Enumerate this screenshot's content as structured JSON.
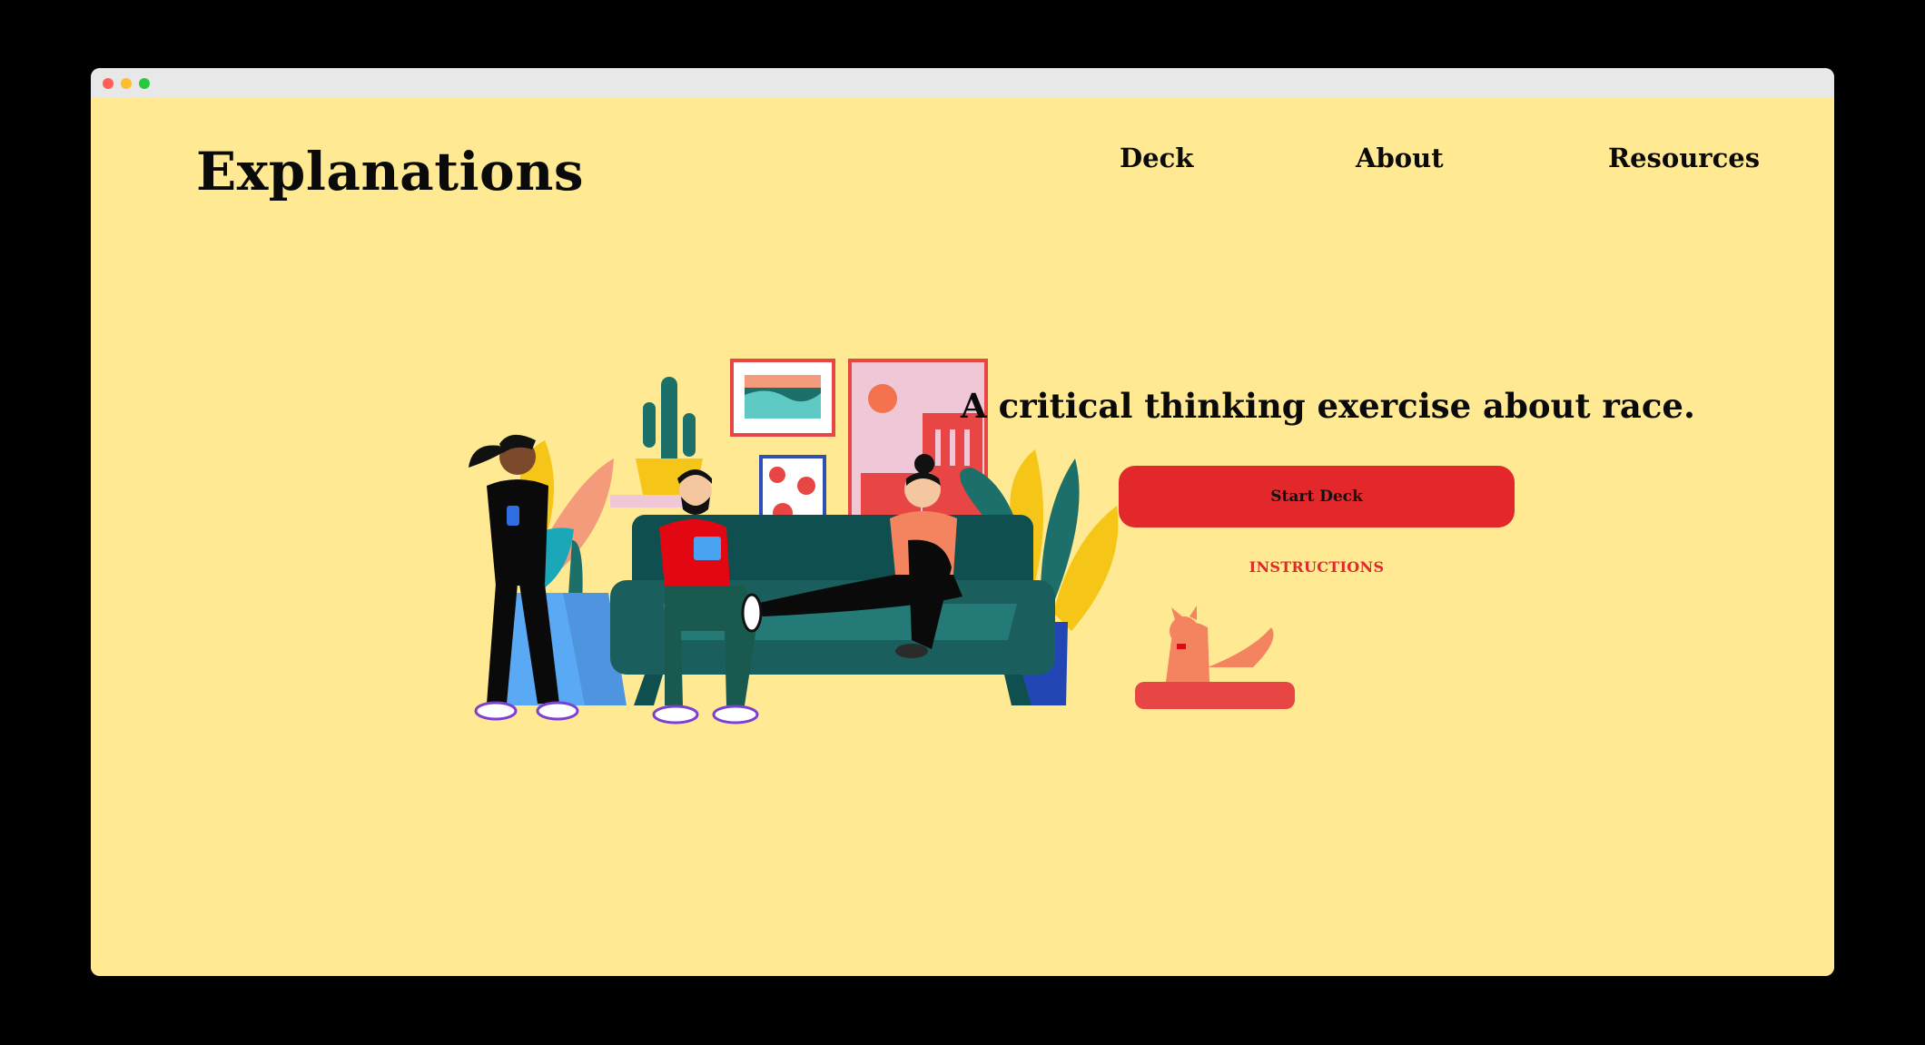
{
  "brand": {
    "title": "Explanations"
  },
  "nav": {
    "items": [
      "Deck",
      "About",
      "Resources"
    ]
  },
  "hero": {
    "tagline": "A critical thinking exercise about race.",
    "start_label": "Start Deck",
    "instructions_label": "INSTRUCTIONS"
  },
  "colors": {
    "page_background": "#ffe993",
    "accent_red": "#e3282b",
    "text": "#0a0a0a",
    "window_chrome": "#e8e8e8",
    "traffic_red": "#ff5f57",
    "traffic_yellow": "#febc2e",
    "traffic_green": "#28c840"
  },
  "illustration": {
    "subject": "living room with people on a sofa, plants, framed pictures and a cat",
    "icons": [
      "person-standing-phone-icon",
      "person-sitting-tablet-icon",
      "person-lounging-icon",
      "cactus-icon",
      "plant-icon",
      "picture-frame-icon",
      "sofa-icon",
      "cat-icon"
    ]
  }
}
